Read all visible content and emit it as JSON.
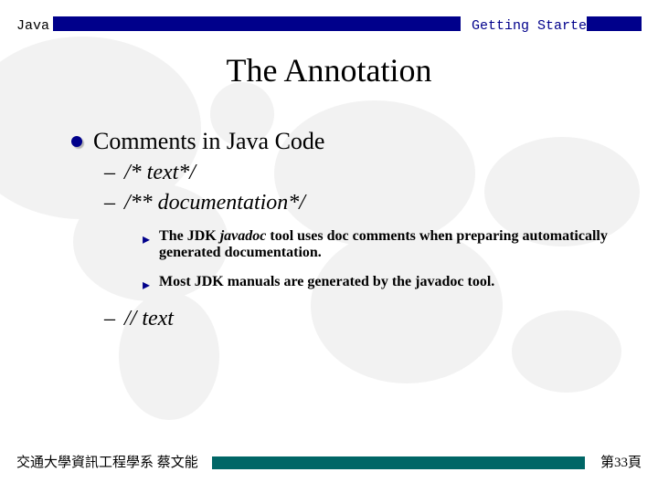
{
  "header": {
    "left": "Java",
    "right": "Getting Started"
  },
  "title": "The Annotation",
  "body": {
    "heading": "Comments in Java Code",
    "item1": "/* text*/",
    "item2": "/** documentation*/",
    "sub1_pre": "The JDK ",
    "sub1_it": "javadoc",
    "sub1_post": " tool uses doc comments when preparing automatically generated documentation.",
    "sub2": "Most JDK manuals are generated by the javadoc tool.",
    "item3": "// text"
  },
  "footer": {
    "left": "交通大學資訊工程學系 蔡文能",
    "right": "第33頁"
  }
}
